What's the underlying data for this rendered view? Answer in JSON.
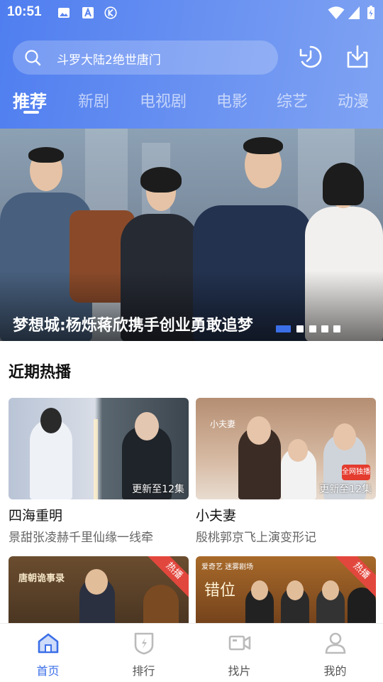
{
  "status_bar": {
    "time": "10:51"
  },
  "search": {
    "placeholder_text": "斗罗大陆2绝世唐门"
  },
  "tabs": [
    {
      "label": "推荐",
      "active": true
    },
    {
      "label": "新剧"
    },
    {
      "label": "电视剧"
    },
    {
      "label": "电影"
    },
    {
      "label": "综艺"
    },
    {
      "label": "动漫"
    }
  ],
  "banner": {
    "caption": "梦想城:杨烁蒋欣携手创业勇敢追梦",
    "slide_count": 5,
    "active_slide": 1
  },
  "section": {
    "title": "近期热播"
  },
  "cards": [
    {
      "title": "四海重明",
      "desc": "景甜张凌赫千里仙缘一线牵",
      "badge": "更新至12集"
    },
    {
      "title": "小夫妻",
      "desc": "殷桃郭京飞上演变形记",
      "badge": "更新至12集",
      "poster_text": "小夫妻",
      "poster_tag": "全网独播"
    },
    {
      "ribbon": "热播",
      "poster_text": "唐朝诡事录"
    },
    {
      "ribbon": "热播",
      "poster_text": "错位",
      "poster_tag": "爱奇艺 迷雾剧场"
    }
  ],
  "bottom_nav": [
    {
      "label": "首页",
      "icon": "home-icon",
      "active": true
    },
    {
      "label": "排行",
      "icon": "ranking-icon"
    },
    {
      "label": "找片",
      "icon": "video-camera-icon"
    },
    {
      "label": "我的",
      "icon": "user-icon"
    }
  ],
  "colors": {
    "accent": "#3a6ee8",
    "header_start": "#4f7ef0",
    "header_end": "#7fa3f3",
    "hot_ribbon": "#e2473d"
  }
}
